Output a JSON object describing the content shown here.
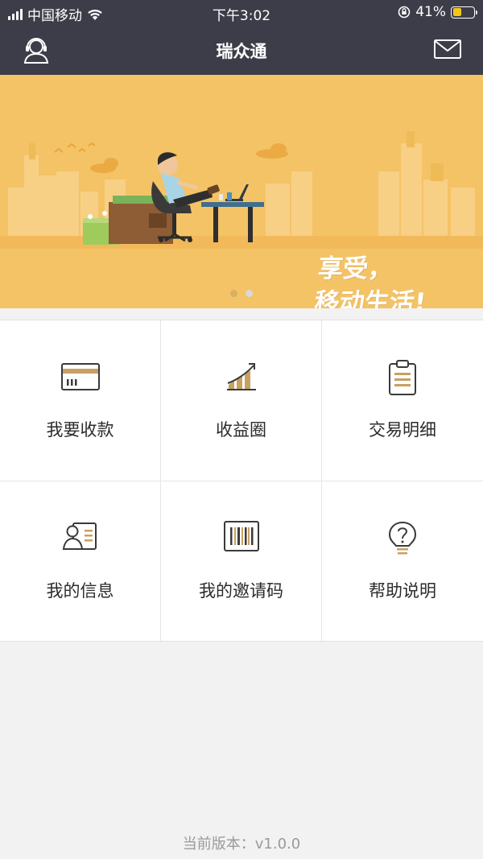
{
  "status_bar": {
    "carrier": "中国移动",
    "time": "下午3:02",
    "battery_percent": "41%",
    "battery_level": 0.41,
    "icons": [
      "signal-icon",
      "wifi-icon",
      "orientation-lock-icon",
      "battery-icon"
    ]
  },
  "navbar": {
    "title": "瑞众通",
    "left_icon": "customer-service-icon",
    "right_icon": "mail-icon"
  },
  "banner": {
    "line1": "享受，",
    "line2": "移动生活!",
    "page_count": 2,
    "active_page": 2
  },
  "colors": {
    "nav_bg": "#3d3d4a",
    "banner_bg": "#f4c366",
    "accent_gold": "#c8a062",
    "page_bg": "#f2f2f2"
  },
  "menu": [
    {
      "label": "我要收款",
      "icon": "card-icon"
    },
    {
      "label": "收益圈",
      "icon": "growth-chart-icon"
    },
    {
      "label": "交易明细",
      "icon": "clipboard-icon"
    },
    {
      "label": "我的信息",
      "icon": "profile-card-icon"
    },
    {
      "label": "我的邀请码",
      "icon": "barcode-icon"
    },
    {
      "label": "帮助说明",
      "icon": "lightbulb-icon"
    }
  ],
  "footer": {
    "version": "当前版本：v1.0.0"
  }
}
